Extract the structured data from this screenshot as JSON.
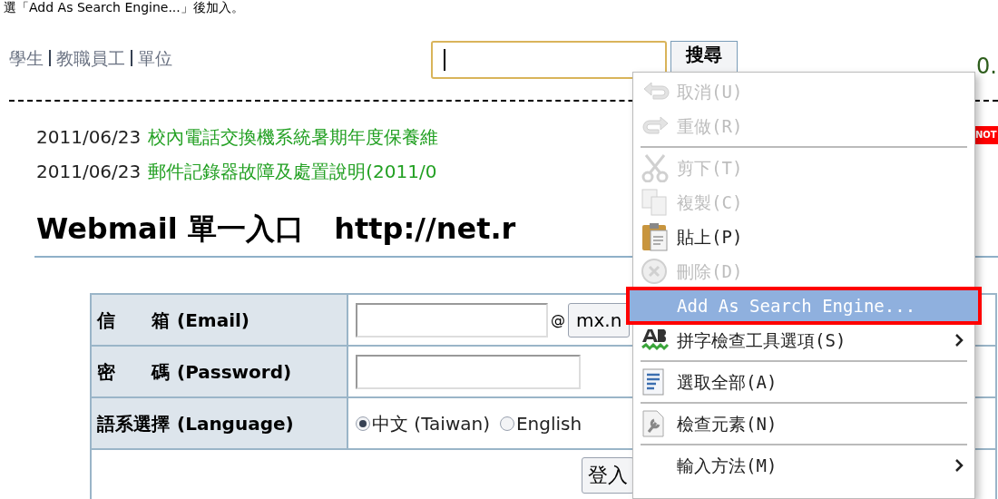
{
  "caption": "選「Add As Search Engine...」後加入。",
  "nav": [
    "學生",
    "教職員工",
    "單位"
  ],
  "search": {
    "button": "搜尋"
  },
  "ip_link": "0.",
  "news": [
    {
      "date": "2011/06/23",
      "title": "校內電話交換機系統暑期年度保養維",
      "badge": "NOT"
    },
    {
      "date": "2011/06/23",
      "title": "郵件記錄器故障及處置說明(2011/0"
    }
  ],
  "heading": "Webmail 單一入口   http://net.r",
  "form": {
    "rows": [
      {
        "kind": "email",
        "label": "信　　箱",
        "label_en": "(Email)",
        "domain": "mx.n",
        "at": "@"
      },
      {
        "kind": "password",
        "label": "密　　碼",
        "label_en": "(Password)"
      },
      {
        "kind": "language",
        "label": "語系選擇",
        "label_en": "(Language)",
        "options": [
          {
            "label": "中文 (Taiwan)",
            "selected": true
          },
          {
            "label": "English",
            "selected": false
          }
        ]
      }
    ],
    "submit": "登入"
  },
  "menu": [
    {
      "kind": "item",
      "label": "取消(U)",
      "disabled": true,
      "selected": false
    },
    {
      "kind": "item",
      "label": "重做(R)",
      "disabled": true,
      "selected": false
    },
    {
      "kind": "separator"
    },
    {
      "kind": "item",
      "label": "剪下(T)",
      "disabled": true,
      "selected": false
    },
    {
      "kind": "item",
      "label": "複製(C)",
      "disabled": true,
      "selected": false
    },
    {
      "kind": "item",
      "label": "貼上(P)",
      "disabled": false,
      "selected": false
    },
    {
      "kind": "item",
      "label": "刪除(D)",
      "disabled": true,
      "selected": false
    },
    {
      "kind": "item",
      "label": "Add As Search Engine...",
      "disabled": false,
      "selected": true,
      "outlined": true
    },
    {
      "kind": "submenu",
      "label": "拼字檢查工具選項(S)",
      "disabled": false,
      "selected": false
    },
    {
      "kind": "separator"
    },
    {
      "kind": "item",
      "label": "選取全部(A)",
      "disabled": false,
      "selected": false
    },
    {
      "kind": "separator"
    },
    {
      "kind": "item",
      "label": "檢查元素(N)",
      "disabled": false,
      "selected": false
    },
    {
      "kind": "separator"
    },
    {
      "kind": "submenu",
      "label": "輸入方法(M)",
      "disabled": false,
      "selected": false
    }
  ]
}
